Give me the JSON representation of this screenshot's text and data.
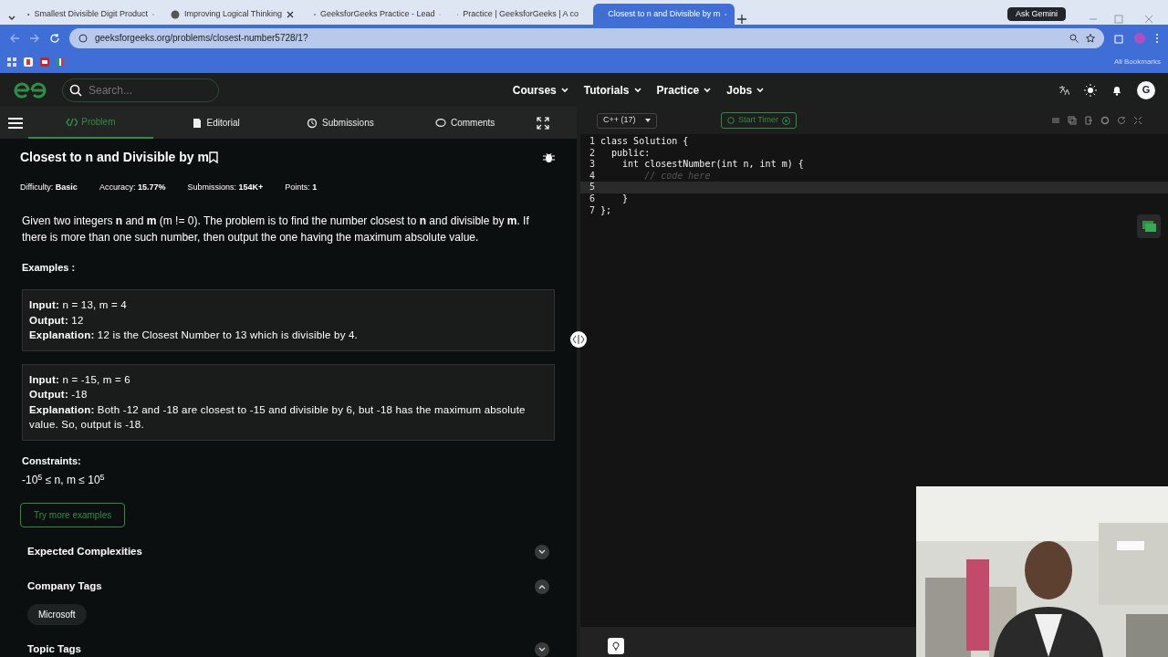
{
  "browser": {
    "tabs": [
      {
        "title": "Smallest Divisible Digit Product",
        "selected": false
      },
      {
        "title": "Improving Logical Thinking",
        "selected": false
      },
      {
        "title": "GeeksforGeeks Practice - Lead",
        "selected": false
      },
      {
        "title": "Practice | GeeksforGeeks | A co",
        "selected": false
      },
      {
        "title": "Closest to n and Divisible by m",
        "selected": true
      }
    ],
    "ask_button": "Ask Gemini",
    "url": "geeksforgeeks.org/problems/closest-number5728/1?",
    "bookmarks_label": "All Bookmarks"
  },
  "site_nav": {
    "search_placeholder": "Search...",
    "menus": [
      "Courses",
      "Tutorials",
      "Practice",
      "Jobs"
    ],
    "avatar": "G"
  },
  "problem_tabs": [
    {
      "label": "Problem",
      "selected": true
    },
    {
      "label": "Editorial",
      "selected": false
    },
    {
      "label": "Submissions",
      "selected": false
    },
    {
      "label": "Comments",
      "selected": false
    }
  ],
  "problem": {
    "title": "Closest to n and Divisible by m",
    "meta": [
      {
        "label": "Difficulty:",
        "value": "Basic"
      },
      {
        "label": "Accuracy:",
        "value": "15.77%"
      },
      {
        "label": "Submissions:",
        "value": "154K+"
      },
      {
        "label": "Points:",
        "value": "1"
      }
    ],
    "statement": "Given two integers **n** and **m** (m != 0). The problem is to find the number closest to **n** and divisible by **m**. If there is more than one such number, then output the one having the maximum absolute value.",
    "examples_heading": "Examples :",
    "examples": [
      {
        "lines": [
          {
            "label": "Input:",
            "text": "n = 13, m = 4"
          },
          {
            "label": "Output:",
            "text": "12"
          },
          {
            "label": "Explanation:",
            "text": "12 is the Closest Number to 13 which is divisible by 4."
          }
        ]
      },
      {
        "lines": [
          {
            "label": "Input:",
            "text": "n = -15, m = 6"
          },
          {
            "label": "Output:",
            "text": "-18"
          },
          {
            "label": "Explanation:",
            "text": "Both -12 and -18 are closest to -15 and divisible by 6, but -18 has the maximum absolute value. So, output is -18."
          }
        ]
      }
    ],
    "constraints_heading": "Constraints:",
    "constraint": "-10$^{5}$ ≤ n, m ≤ 10$^{5}$",
    "try_button": "Try more examples",
    "sections": [
      {
        "title": "Expected Complexities",
        "expanded": false
      },
      {
        "title": "Company Tags",
        "expanded": true,
        "tags": [
          "Microsoft"
        ]
      },
      {
        "title": "Topic Tags",
        "expanded": false
      }
    ]
  },
  "editor": {
    "language": "C++ (17)",
    "timer_button": "Start Timer",
    "lines": [
      {
        "number": "1",
        "text": "class Solution {",
        "kind": "code",
        "active": false
      },
      {
        "number": "2",
        "text": "  public:",
        "kind": "code",
        "active": false
      },
      {
        "number": "3",
        "text": "    int closestNumber(int n, int m) {",
        "kind": "code",
        "active": false
      },
      {
        "number": "4",
        "text": "        // code here",
        "kind": "comment",
        "active": false
      },
      {
        "number": "5",
        "kind": "code",
        "active": true
      },
      {
        "number": "6",
        "text": "    }",
        "kind": "code",
        "active": false
      },
      {
        "number": "7",
        "text": "};",
        "kind": "code",
        "active": false
      }
    ]
  }
}
